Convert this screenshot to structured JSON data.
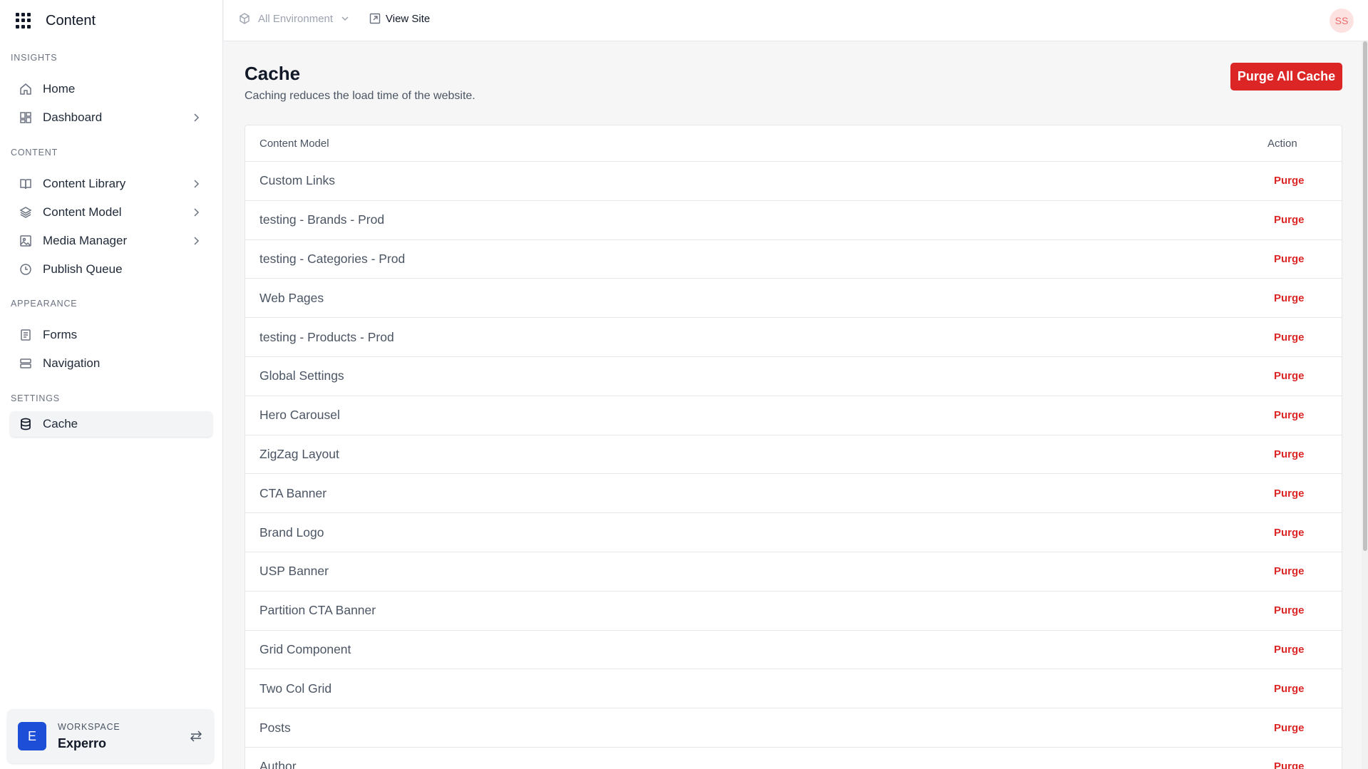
{
  "app": {
    "title": "Content"
  },
  "sidebar": {
    "sections": {
      "insights": "INSIGHTS",
      "content": "CONTENT",
      "appearance": "APPEARANCE",
      "settings": "SETTINGS"
    },
    "items": {
      "home": "Home",
      "dashboard": "Dashboard",
      "content_library": "Content Library",
      "content_model": "Content Model",
      "media_manager": "Media Manager",
      "publish_queue": "Publish Queue",
      "forms": "Forms",
      "navigation": "Navigation",
      "cache": "Cache"
    },
    "active_item": "Cache",
    "workspace": {
      "label": "WORKSPACE",
      "name": "Experro",
      "initial": "E"
    }
  },
  "topbar": {
    "environment": "All Environment",
    "view_site": "View Site",
    "user_initials": "SS"
  },
  "page": {
    "title": "Cache",
    "subtitle": "Caching reduces the load time of the website.",
    "purge_all_label": "Purge All Cache"
  },
  "table": {
    "headers": {
      "content_model": "Content Model",
      "action": "Action"
    },
    "action_label": "Purge",
    "rows": [
      "Custom Links",
      "testing - Brands - Prod",
      "testing - Categories - Prod",
      "Web Pages",
      "testing - Products - Prod",
      "Global Settings",
      "Hero Carousel",
      "ZigZag Layout",
      "CTA Banner",
      "Brand Logo",
      "USP Banner",
      "Partition CTA Banner",
      "Grid Component",
      "Two Col Grid",
      "Posts",
      "Author"
    ]
  },
  "colors": {
    "accent": "#dc2626",
    "workspace_avatar": "#1d4ed8",
    "user_avatar_bg": "#fde2e2"
  }
}
